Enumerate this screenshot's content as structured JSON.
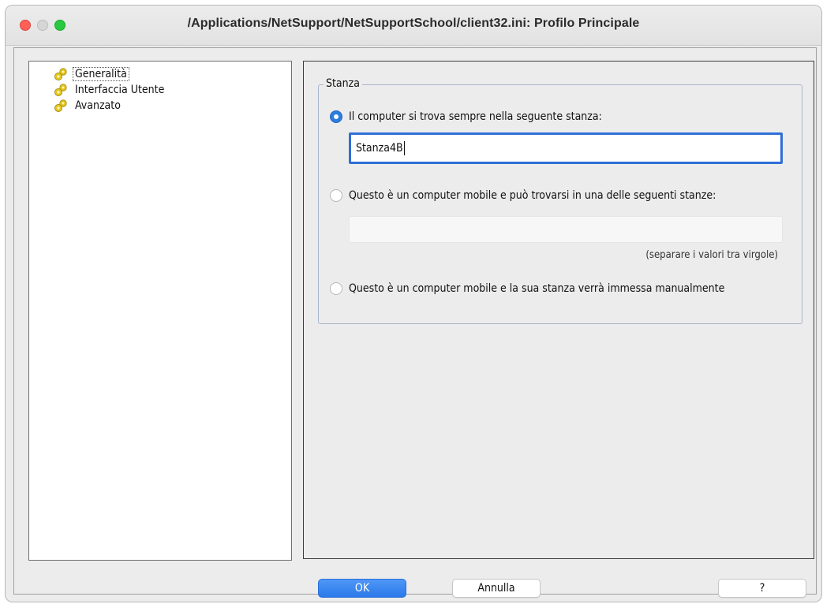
{
  "window": {
    "title": "/Applications/NetSupport/NetSupportSchool/client32.ini: Profilo Principale"
  },
  "tree": {
    "items": [
      {
        "label": "Generalità",
        "selected": true
      },
      {
        "label": "Interfaccia Utente",
        "selected": false
      },
      {
        "label": "Avanzato",
        "selected": false
      }
    ]
  },
  "stanza": {
    "legend": "Stanza",
    "option1": "Il computer si trova sempre nella seguente stanza:",
    "room_value": "Stanza4B",
    "option2": "Questo è un computer mobile e può trovarsi in una delle seguenti stanze:",
    "rooms_list_value": "",
    "hint": "(separare i valori tra virgole)",
    "option3": "Questo è un computer mobile e la sua stanza verrà immessa manualmente",
    "selected_option": 1
  },
  "buttons": {
    "ok": "OK",
    "cancel": "Annulla",
    "help": "?"
  },
  "colors": {
    "accent": "#2b7de0",
    "close": "#fe5f57",
    "zoom": "#28c840",
    "icon": "#e6c619"
  },
  "icons": {
    "tree_item": "gears-icon"
  }
}
